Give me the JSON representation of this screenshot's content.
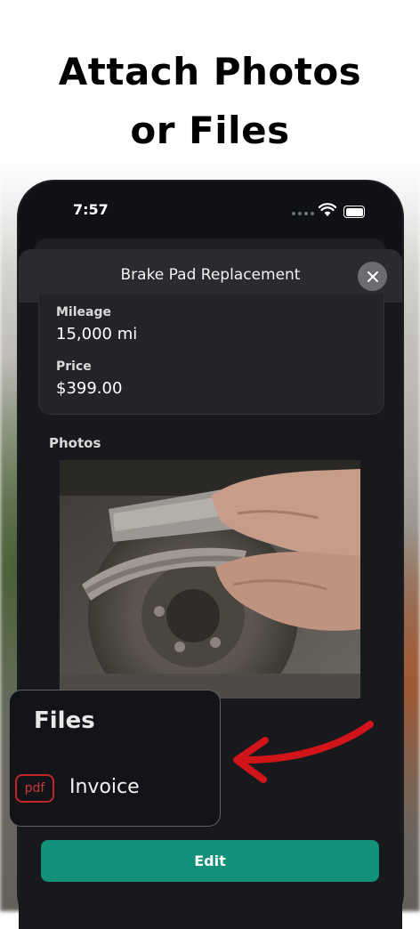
{
  "promo": {
    "headline_line1": "Attach Photos",
    "headline_line2": "or Files"
  },
  "status_bar": {
    "time": "7:57"
  },
  "sheet": {
    "title": "Brake Pad Replacement",
    "fields": [
      {
        "label": "Mileage",
        "value": "15,000 mi"
      },
      {
        "label": "Price",
        "value": "$399.00"
      }
    ],
    "photos_label": "Photos",
    "files": {
      "title": "Files",
      "items": [
        {
          "type_badge": "pdf",
          "name": "Invoice"
        }
      ]
    },
    "edit_label": "Edit"
  },
  "colors": {
    "accent": "#12907a",
    "arrow": "#d0141a",
    "pdf": "#c0262a"
  },
  "icons": [
    "wifi-icon",
    "battery-icon",
    "close-icon",
    "arrow-icon"
  ]
}
